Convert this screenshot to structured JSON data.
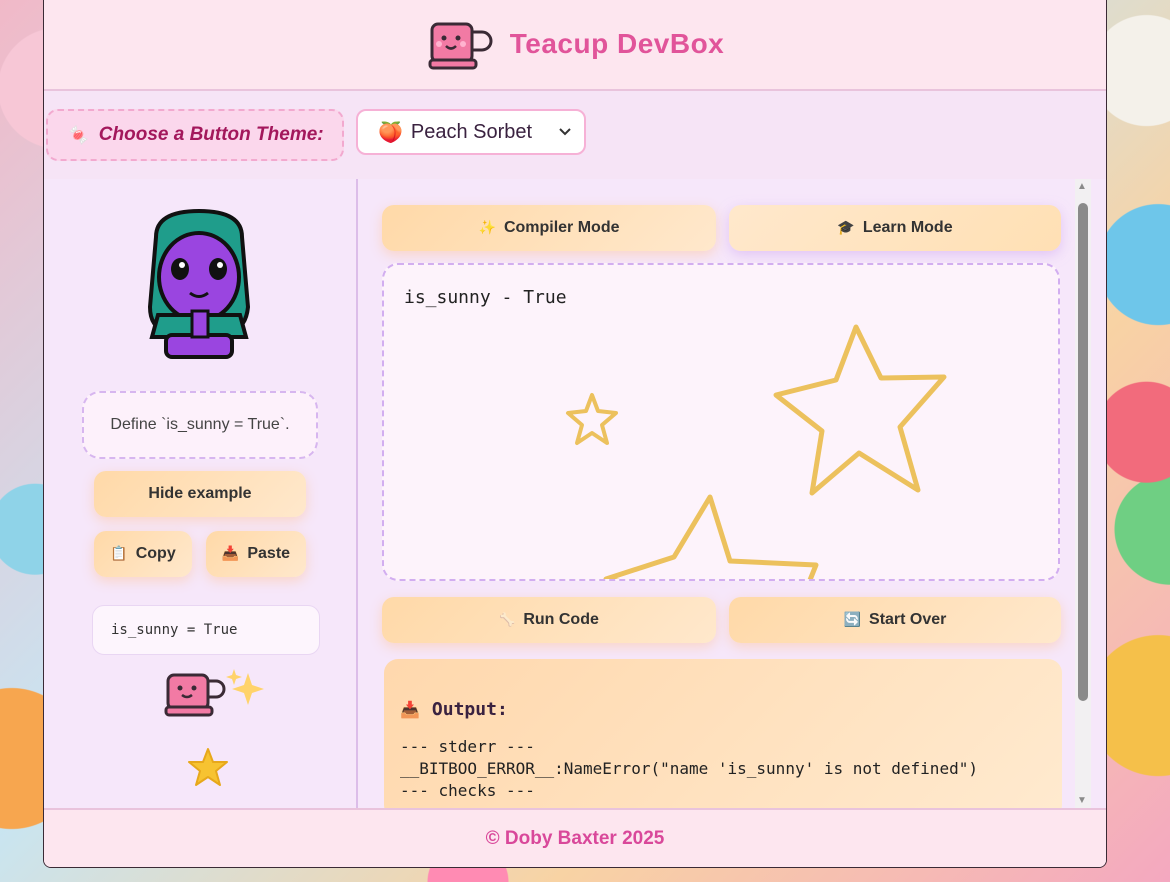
{
  "app": {
    "title": "Teacup DevBox"
  },
  "theme": {
    "label": "Choose a Button Theme:",
    "selected": "Peach Sorbet",
    "selected_icon": "peach-icon"
  },
  "sidebar": {
    "task": "Define `is_sunny = True`.",
    "hide_example_label": "Hide example",
    "copy_label": "Copy",
    "paste_label": "Paste",
    "example_code": "is_sunny = True"
  },
  "modes": {
    "compiler_label": "Compiler Mode",
    "learn_label": "Learn Mode"
  },
  "editor": {
    "code": "is_sunny - True"
  },
  "actions": {
    "run_label": "Run Code",
    "reset_label": "Start Over"
  },
  "output": {
    "title": "Output:",
    "lines": "--- stderr ---\n__BITBOO_ERROR__:NameError(\"name 'is_sunny' is not defined\")\n--- checks ---"
  },
  "footer": {
    "text": "© Doby Baxter 2025"
  },
  "colors": {
    "accent": "#e1549a",
    "button": "#ffd9a8",
    "star": "#ecc15d"
  }
}
